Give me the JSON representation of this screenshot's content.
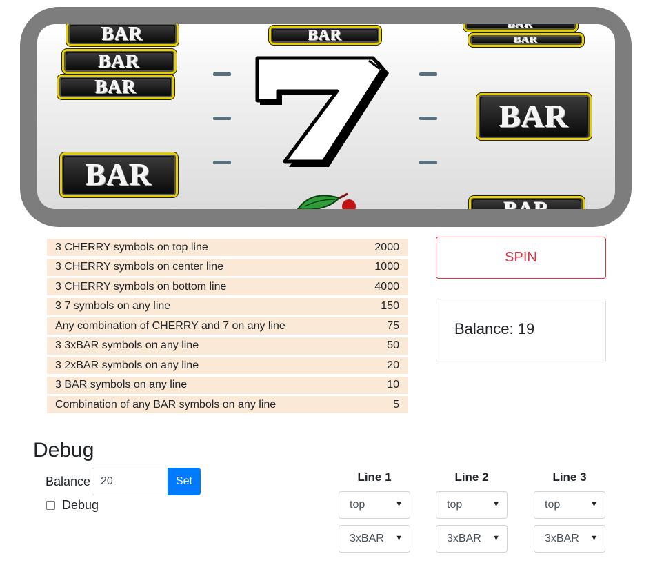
{
  "machine": {
    "reel_symbols": {
      "bar": "BAR",
      "seven": "7",
      "cherry": "cherry"
    },
    "colors": {
      "frame": "#7d7d7d",
      "bar_border": "#e6cf00",
      "payline_marker": "#56707e",
      "cherry_leaf": "#2f9e3a"
    }
  },
  "paytable": {
    "rows": [
      {
        "label": "3 CHERRY symbols on top line",
        "value": "2000"
      },
      {
        "label": "3 CHERRY symbols on center line",
        "value": "1000"
      },
      {
        "label": "3 CHERRY symbols on bottom line",
        "value": "4000"
      },
      {
        "label": "3 7 symbols on any line",
        "value": "150"
      },
      {
        "label": "Any combination of CHERRY and 7 on any line",
        "value": "75"
      },
      {
        "label": "3 3xBAR symbols on any line",
        "value": "50"
      },
      {
        "label": "3 2xBAR symbols on any line",
        "value": "20"
      },
      {
        "label": "3 BAR symbols on any line",
        "value": "10"
      },
      {
        "label": "Combination of any BAR symbols on any line",
        "value": "5"
      }
    ],
    "row_color": "#fbe9d7"
  },
  "controls": {
    "spin_label": "SPIN",
    "spin_color": "#dc3545",
    "balance_text": "Balance: 19"
  },
  "debug": {
    "title": "Debug",
    "balance_label": "Balance",
    "balance_value": "20",
    "set_label": "Set",
    "set_color": "#007bff",
    "checkbox_label": "Debug",
    "checkbox_checked": false,
    "lines": [
      {
        "heading": "Line 1",
        "position": "top",
        "symbol": "3xBAR"
      },
      {
        "heading": "Line 2",
        "position": "top",
        "symbol": "3xBAR"
      },
      {
        "heading": "Line 3",
        "position": "top",
        "symbol": "3xBAR"
      }
    ],
    "dropdown_icon": "caret-down-icon"
  }
}
